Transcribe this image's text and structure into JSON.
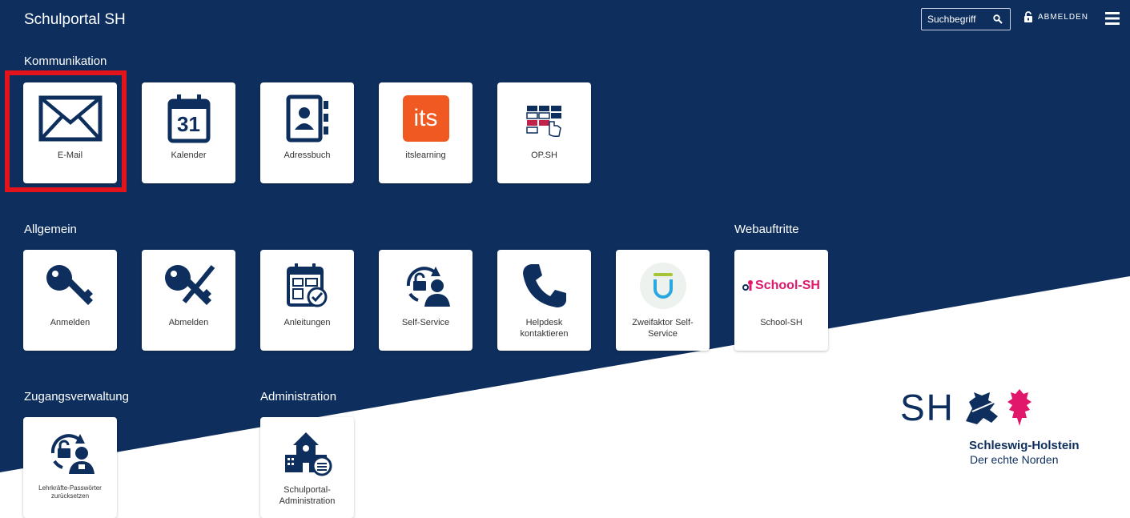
{
  "header": {
    "app_title": "Schulportal SH",
    "search_label": "Suchbegriff",
    "logout_label": "ABMELDEN"
  },
  "sections": {
    "kommunikation": "Kommunikation",
    "allgemein": "Allgemein",
    "webauftritte": "Webauftritte",
    "zugangsverwaltung": "Zugangsverwaltung",
    "administration": "Administration"
  },
  "tiles": {
    "email": "E-Mail",
    "kalender": "Kalender",
    "kalender_day": "31",
    "adressbuch": "Adressbuch",
    "itslearning": "itslearning",
    "itslearning_logo": "its",
    "opsh": "OP.SH",
    "anmelden": "Anmelden",
    "abmelden": "Abmelden",
    "anleitungen": "Anleitungen",
    "self_service": "Self-Service",
    "helpdesk": "Helpdesk kontaktieren",
    "zweifaktor": "Zweifaktor Self-Service",
    "school_sh": "School-SH",
    "school_sh_logo": "School-SH",
    "lehrkraefte": "Lehrkräfte-Passwörter zurücksetzen",
    "schulportal_admin": "Schulportal-Administration"
  },
  "branding": {
    "sh_letters": "SH",
    "state_name": "Schleswig-Holstein",
    "slogan": "Der echte Norden"
  },
  "colors": {
    "navy": "#0e2f5e",
    "highlight": "#e1141b",
    "its_orange": "#f05a22",
    "school_pink": "#e0176b"
  }
}
